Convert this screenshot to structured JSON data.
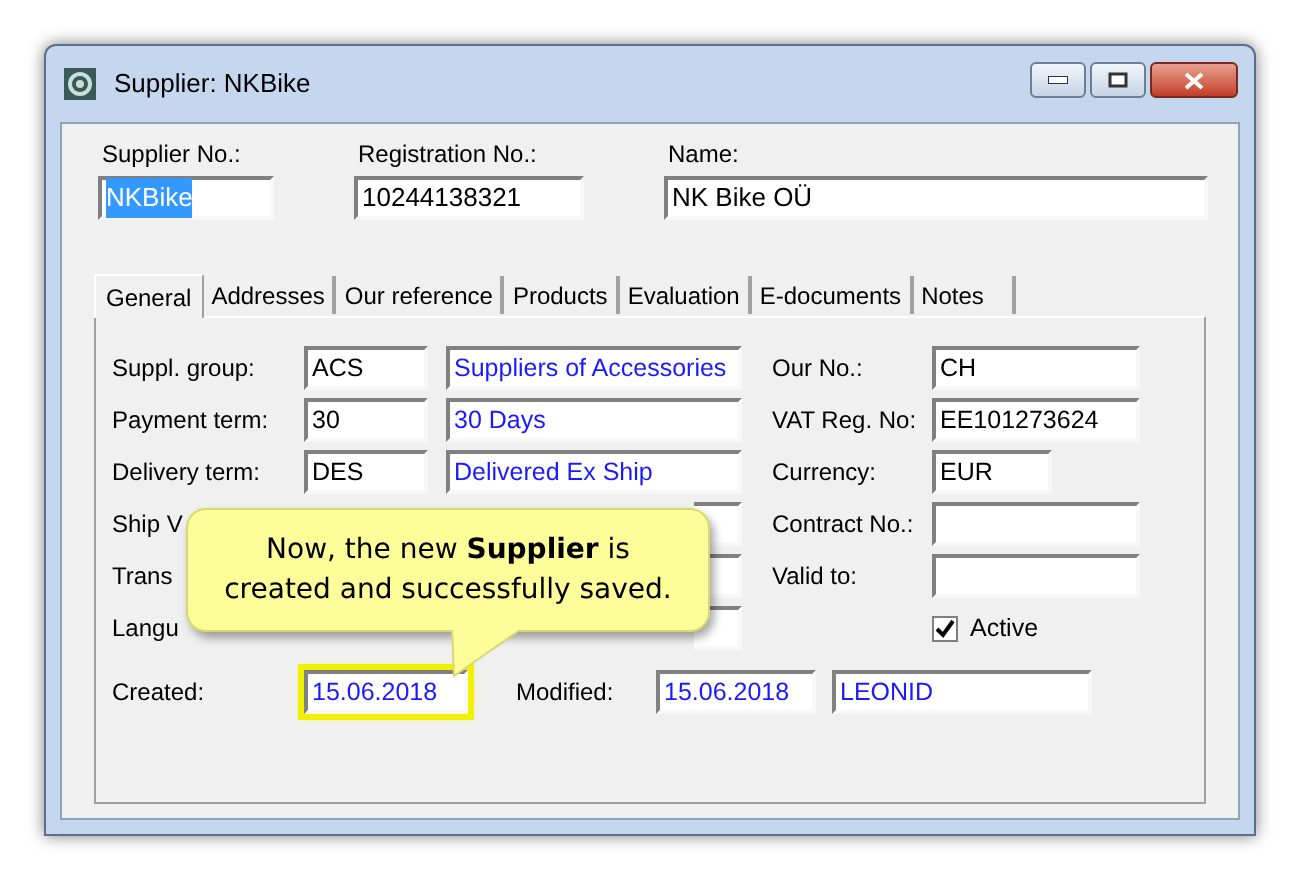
{
  "window": {
    "title": "Supplier: NKBike"
  },
  "header": [
    {
      "label": "Supplier No.:",
      "value": "NKBike",
      "selected": true
    },
    {
      "label": "Registration No.:",
      "value": "10244138321",
      "selected": false
    },
    {
      "label": "Name:",
      "value": "NK Bike OÜ",
      "selected": false
    }
  ],
  "tabs": [
    {
      "label": "General",
      "selected": true
    },
    {
      "label": "Addresses",
      "selected": false
    },
    {
      "label": "Our reference",
      "selected": false
    },
    {
      "label": "Products",
      "selected": false
    },
    {
      "label": "Evaluation",
      "selected": false
    },
    {
      "label": "E-documents",
      "selected": false
    },
    {
      "label": "Notes",
      "selected": false
    }
  ],
  "left_rows": [
    {
      "label": "Suppl. group:",
      "code": "ACS",
      "description": "Suppliers of Accessories"
    },
    {
      "label": "Payment term:",
      "code": "30",
      "description": "30 Days"
    },
    {
      "label": "Delivery term:",
      "code": "DES",
      "description": "Delivered Ex Ship"
    },
    {
      "label": "Ship V",
      "code": "",
      "description": ""
    },
    {
      "label": "Trans",
      "code": "",
      "description": ""
    },
    {
      "label": "Langu",
      "code": "",
      "description": ""
    }
  ],
  "right_rows": [
    {
      "kind": "field",
      "label": "Our No.:",
      "value": "CH"
    },
    {
      "kind": "field",
      "label": "VAT Reg. No:",
      "value": "EE101273624"
    },
    {
      "kind": "short",
      "label": "Currency:",
      "value": "EUR"
    },
    {
      "kind": "field",
      "label": "Contract No.:",
      "value": ""
    },
    {
      "kind": "field",
      "label": "Valid to:",
      "value": ""
    },
    {
      "kind": "checkbox",
      "label": "Active",
      "checked": true
    }
  ],
  "created": {
    "label": "Created:",
    "value": "15.06.2018",
    "highlighted": true
  },
  "modified": {
    "label": "Modified:",
    "value": "15.06.2018",
    "user": "LEONID"
  },
  "callout": {
    "text": "Now, the new **Supplier** is created and successfully saved."
  }
}
